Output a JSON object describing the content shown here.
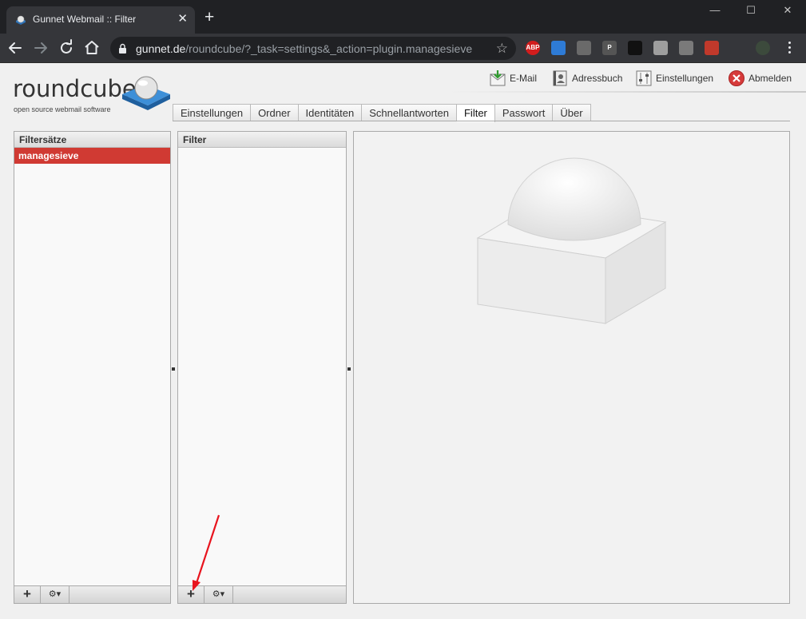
{
  "browser": {
    "tab_title": "Gunnet Webmail :: Filter",
    "tab_close": "✕",
    "new_tab": "+",
    "window_controls": {
      "minimize": "—",
      "maximize": "☐",
      "close": "✕"
    },
    "url_host": "gunnet.de",
    "url_path": "/roundcube/?_task=settings&_action=plugin.managesieve",
    "star": "☆",
    "extensions": [
      {
        "name": "adblock-plus-icon",
        "label": "ABP",
        "color": "#d21d1d"
      },
      {
        "name": "icloud-icon",
        "label": "",
        "color": "#2e7bd6"
      },
      {
        "name": "print-icon",
        "label": "",
        "color": "#6a6a6a"
      },
      {
        "name": "p-extension-icon",
        "label": "P",
        "color": "#555555"
      },
      {
        "name": "lock-extension-icon",
        "label": "",
        "color": "#111111"
      },
      {
        "name": "check-extension-icon",
        "label": "",
        "color": "#9e9e9e"
      },
      {
        "name": "shield-extension-icon",
        "label": "",
        "color": "#7a7a7a"
      },
      {
        "name": "chart-extension-icon",
        "label": "",
        "color": "#c0392b"
      },
      {
        "name": "puzzle-icon",
        "label": "",
        "color": "#35363a"
      },
      {
        "name": "avatar-icon",
        "label": "",
        "color": "#3c4a3c"
      }
    ]
  },
  "app": {
    "logo_word": "roundcube",
    "logo_sub": "open source webmail software",
    "taskbar": {
      "mail": "E-Mail",
      "addressbook": "Adressbuch",
      "settings": "Einstellungen",
      "logout": "Abmelden"
    },
    "tabs": [
      "Einstellungen",
      "Ordner",
      "Identitäten",
      "Schnellantworten",
      "Filter",
      "Passwort",
      "Über"
    ],
    "active_tab": "Filter",
    "filtersets": {
      "title": "Filtersätze",
      "items": [
        "managesieve"
      ],
      "add": "+",
      "actions": "⚙▾"
    },
    "filters": {
      "title": "Filter",
      "add": "+",
      "actions": "⚙▾"
    },
    "colors": {
      "selected_row": "#d03a33",
      "annotation_arrow": "#e8141e"
    }
  }
}
